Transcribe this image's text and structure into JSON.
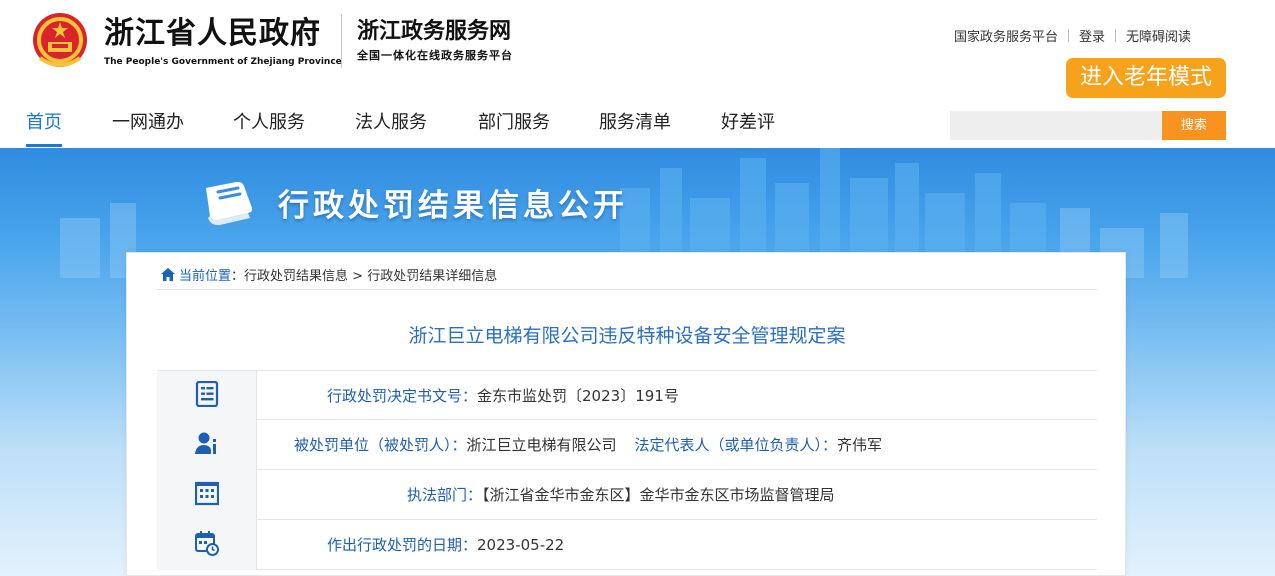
{
  "header": {
    "gov_name_cn": "浙江省人民政府",
    "gov_name_en": "The People's Government of Zhejiang Province",
    "service_name": "浙江政务服务网",
    "service_sub": "全国一体化在线政务服务平台",
    "top_links": [
      "国家政务服务平台",
      "登录",
      "无障碍阅读"
    ],
    "elder_mode": "进入老年模式",
    "search_button": "搜索",
    "search_placeholder": ""
  },
  "nav": {
    "items": [
      "首页",
      "一网通办",
      "个人服务",
      "法人服务",
      "部门服务",
      "服务清单",
      "好差评"
    ],
    "active": "首页"
  },
  "banner": {
    "title": "行政处罚结果信息公开"
  },
  "breadcrumb": {
    "current_label": "当前位置",
    "colon": "：",
    "path": "行政处罚结果信息 > 行政处罚结果详细信息"
  },
  "case": {
    "title": "浙江巨立电梯有限公司违反特种设备安全管理规定案",
    "rows": [
      {
        "icon": "document-icon",
        "label": "行政处罚决定书文号：",
        "value": "金东市监处罚〔2023〕191号"
      },
      {
        "icon": "person-info-icon",
        "label": "被处罚单位（被处罚人）：",
        "value": "浙江巨立电梯有限公司",
        "label2": "法定代表人（或单位负责人）：",
        "value2": "齐伟军"
      },
      {
        "icon": "building-icon",
        "label": "执法部门：",
        "value": "【浙江省金华市金东区】金华市金东区市场监督管理局"
      },
      {
        "icon": "calendar-clock-icon",
        "label": "作出行政处罚的日期：",
        "value": "2023-05-22"
      }
    ]
  },
  "colors": {
    "accent_blue": "#1a78d6",
    "orange": "#f7a21b",
    "title_blue": "#2a6fc2"
  }
}
